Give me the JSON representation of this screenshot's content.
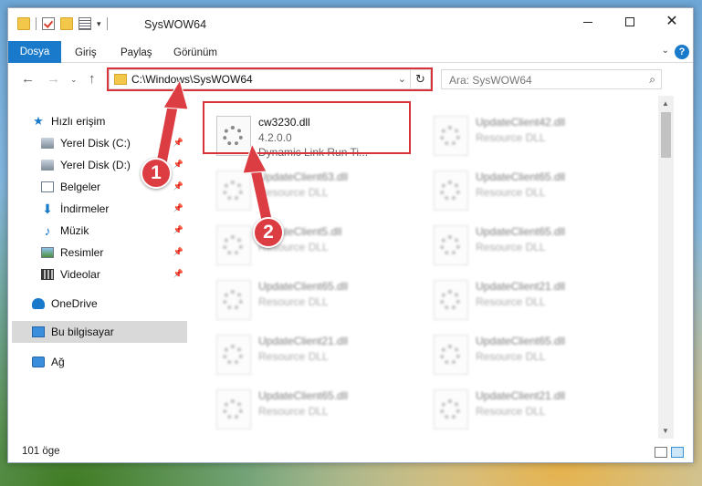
{
  "window": {
    "title": "SysWOW64"
  },
  "ribbon": {
    "tabs": [
      "Dosya",
      "Giriş",
      "Paylaş",
      "Görünüm"
    ]
  },
  "address": {
    "path": "C:\\Windows\\SysWOW64"
  },
  "search": {
    "placeholder": "Ara: SysWOW64"
  },
  "sidebar": {
    "items": [
      {
        "label": "Hızlı erişim",
        "icon": "star-icon"
      },
      {
        "label": "Yerel Disk (C:)",
        "icon": "disk-icon",
        "pinned": true
      },
      {
        "label": "Yerel Disk (D:)",
        "icon": "disk-icon",
        "pinned": true
      },
      {
        "label": "Belgeler",
        "icon": "documents-icon",
        "pinned": true
      },
      {
        "label": "İndirmeler",
        "icon": "downloads-icon",
        "pinned": true
      },
      {
        "label": "Müzik",
        "icon": "music-icon",
        "pinned": true
      },
      {
        "label": "Resimler",
        "icon": "pictures-icon",
        "pinned": true
      },
      {
        "label": "Videolar",
        "icon": "videos-icon",
        "pinned": true
      },
      {
        "label": "OneDrive",
        "icon": "onedrive-icon"
      },
      {
        "label": "Bu bilgisayar",
        "icon": "computer-icon",
        "selected": true
      },
      {
        "label": "Ağ",
        "icon": "network-icon"
      }
    ]
  },
  "files": [
    {
      "name": "cw3230.dll",
      "line2": "4.2.0.0",
      "line3": "Dynamic Link Run Ti...",
      "highlighted": true
    },
    {
      "name": "UpdateClient42.dll",
      "line2": "Resource DLL"
    },
    {
      "name": "UpdateClient63.dll",
      "line2": "Resource DLL"
    },
    {
      "name": "UpdateClient65.dll",
      "line2": "Resource DLL"
    },
    {
      "name": "UpdateClient5.dll",
      "line2": "Resource DLL"
    },
    {
      "name": "UpdateClient65.dll",
      "line2": "Resource DLL"
    },
    {
      "name": "UpdateClient65.dll",
      "line2": "Resource DLL"
    },
    {
      "name": "UpdateClient21.dll",
      "line2": "Resource DLL"
    },
    {
      "name": "UpdateClient21.dll",
      "line2": "Resource DLL"
    },
    {
      "name": "UpdateClient65.dll",
      "line2": "Resource DLL"
    },
    {
      "name": "UpdateClient65.dll",
      "line2": "Resource DLL"
    },
    {
      "name": "UpdateClient21.dll",
      "line2": "Resource DLL"
    }
  ],
  "status": {
    "count": "101 öge"
  },
  "callouts": [
    "1",
    "2"
  ],
  "colors": {
    "accent": "#1979ca",
    "highlight": "#d9333a"
  }
}
